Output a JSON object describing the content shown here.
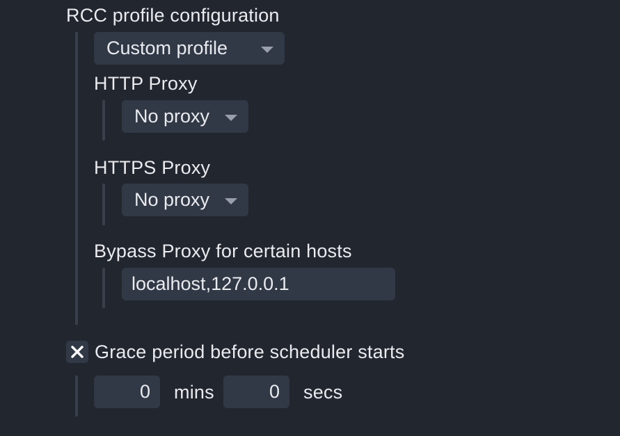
{
  "rcc": {
    "title": "RCC profile configuration",
    "profile_value": "Custom profile"
  },
  "http_proxy": {
    "label": "HTTP Proxy",
    "value": "No proxy"
  },
  "https_proxy": {
    "label": "HTTPS Proxy",
    "value": "No proxy"
  },
  "bypass_proxy": {
    "label": "Bypass Proxy for certain hosts",
    "value": "localhost,127.0.0.1"
  },
  "grace_period": {
    "label": "Grace period before scheduler starts",
    "checked_icon": "close-x-icon",
    "mins_value": "0",
    "mins_unit": "mins",
    "secs_value": "0",
    "secs_unit": "secs"
  }
}
